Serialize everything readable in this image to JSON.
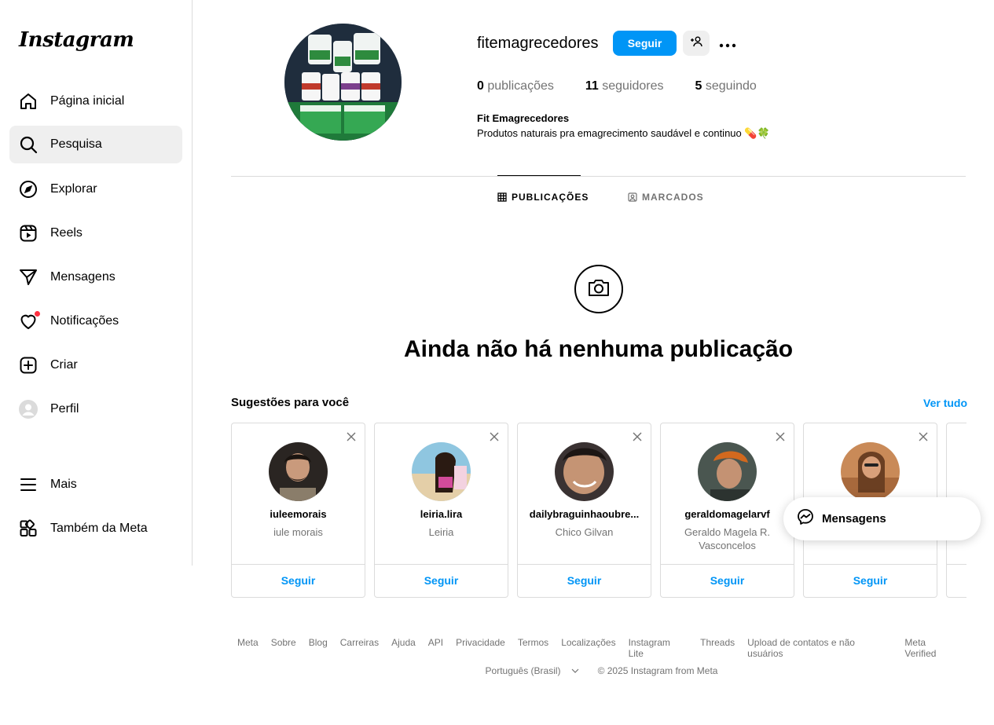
{
  "app": {
    "logo": "Instagram"
  },
  "sidebar": {
    "items": [
      {
        "label": "Página inicial",
        "icon": "home-icon"
      },
      {
        "label": "Pesquisa",
        "icon": "search-icon",
        "active": true
      },
      {
        "label": "Explorar",
        "icon": "compass-icon"
      },
      {
        "label": "Reels",
        "icon": "reels-icon"
      },
      {
        "label": "Mensagens",
        "icon": "send-icon"
      },
      {
        "label": "Notificações",
        "icon": "heart-icon",
        "badge": true
      },
      {
        "label": "Criar",
        "icon": "plus-square-icon"
      },
      {
        "label": "Perfil",
        "icon": "avatar-icon"
      },
      {
        "label": "Mais",
        "icon": "menu-icon"
      },
      {
        "label": "Também da Meta",
        "icon": "grid-icon"
      }
    ]
  },
  "profile": {
    "username": "fitemagrecedores",
    "follow_label": "Seguir",
    "stats": [
      {
        "count": "0",
        "label": "publicações"
      },
      {
        "count": "11",
        "label": "seguidores"
      },
      {
        "count": "5",
        "label": "seguindo"
      }
    ],
    "full_name": "Fit Emagrecedores",
    "bio": "Produtos naturais pra emagrecimento saudável e continuo 💊🍀"
  },
  "tabs": [
    {
      "label": "PUBLICAÇÕES",
      "icon": "grid-icon",
      "active": true
    },
    {
      "label": "MARCADOS",
      "icon": "tagged-icon"
    }
  ],
  "empty_state": {
    "icon": "camera-icon",
    "title": "Ainda não há nenhuma publicação"
  },
  "suggestions": {
    "title": "Sugestões para você",
    "see_all": "Ver tudo",
    "cards": [
      {
        "username": "iuleemorais",
        "name": "iule morais",
        "follow": "Seguir"
      },
      {
        "username": "leiria.lira",
        "name": "Leiria",
        "follow": "Seguir"
      },
      {
        "username": "dailybraguinhaoubre...",
        "name": "Chico Gilvan",
        "follow": "Seguir"
      },
      {
        "username": "geraldomagelarvf",
        "name": "Geraldo Magela R. Vasconcelos",
        "follow": "Seguir"
      },
      {
        "username": "",
        "name": "",
        "follow": "Seguir"
      }
    ]
  },
  "messages_pill": {
    "label": "Mensagens",
    "icon": "messenger-icon"
  },
  "footer": {
    "links": [
      "Meta",
      "Sobre",
      "Blog",
      "Carreiras",
      "Ajuda",
      "API",
      "Privacidade",
      "Termos",
      "Localizações",
      "Instagram Lite",
      "Threads",
      "Upload de contatos e não usuários",
      "Meta Verified"
    ],
    "language": "Português (Brasil)",
    "copyright": "© 2025 Instagram from Meta"
  },
  "colors": {
    "accent": "#0095f6",
    "badge": "#ff3040",
    "muted": "#737373",
    "border": "#dbdbdb"
  }
}
